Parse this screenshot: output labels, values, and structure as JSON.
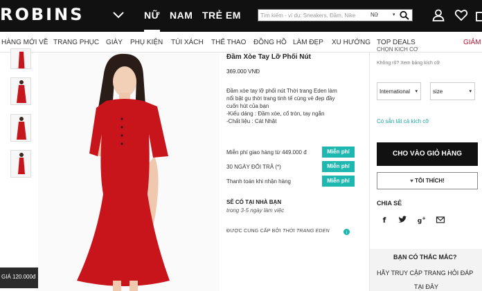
{
  "header": {
    "logo": "ROBINS",
    "nav": [
      "NỮ",
      "NAM",
      "TRẺ EM"
    ],
    "search_placeholder": "Tìm kiếm - ví dụ: Sneakers, Đầm, Nike",
    "search_category": "Nữ",
    "icons": [
      "account-icon",
      "heart-icon",
      "bag-icon"
    ]
  },
  "categories": {
    "items": [
      "HÀNG MỚI VỀ",
      "TRANG PHỤC",
      "GIÀY",
      "PHỤ KIỆN",
      "TÚI XÁCH",
      "THỂ THAO",
      "ĐỒNG HỒ",
      "LÀM ĐẸP",
      "XU HƯỚNG",
      "TOP DEALS",
      "GIẢM S"
    ]
  },
  "gallery": {
    "price_badge": "GIÁ 120.000đ"
  },
  "product": {
    "title": "Đầm Xòe Tay Lỡ Phối Nút",
    "price": "369.000 VNĐ",
    "desc": [
      "Đầm xòe tay lỡ phối nút Thời trang Eden làm",
      "nổi bật gu thời trang tinh tế cùng vẻ đẹp đầy",
      "cuốn hút của bạn",
      "-Kiểu dáng : Đầm xòe, cổ tròn, tay ngắn",
      "-Chất liệu : Cát Nhật"
    ],
    "perks": [
      {
        "label": "Miễn phí giao hàng từ 449.000 đ",
        "badge": "Miễn phí"
      },
      {
        "label": "30 NGÀY ĐỔI TRẢ (*)",
        "badge": "Miễn phí"
      },
      {
        "label": "Thanh toán khi nhận hàng",
        "badge": "Miễn phí"
      }
    ],
    "store_title": "SẼ CÓ TẠI NHÀ BẠN",
    "store_sub": "trong 3-5 ngày làm việc",
    "supplier_prefix": "ĐƯỢC CUNG CẤP BỞI",
    "supplier_name": "THỜI TRANG EDEN"
  },
  "side": {
    "cut_heading": "CHỌN KÍCH CỠ",
    "size_help": "Không rõ?  Xem bảng kích cỡ",
    "region_select": "International",
    "size_select": "size",
    "stock_note": "Có sẵn tất cả kích cỡ",
    "add_to_cart": "CHO VÀO GIỎ HÀNG",
    "like": "TÔI THÍCH!",
    "share_title": "CHIA SẺ",
    "share_icons": [
      "facebook-icon",
      "twitter-icon",
      "google-plus-icon",
      "email-icon"
    ],
    "help_q": "BẠN CÓ THẮC MẮC?",
    "help_a1": "HÃY TRUY CẬP TRANG HỎI ĐÁP",
    "help_a2": "TẠI ĐÂY"
  }
}
